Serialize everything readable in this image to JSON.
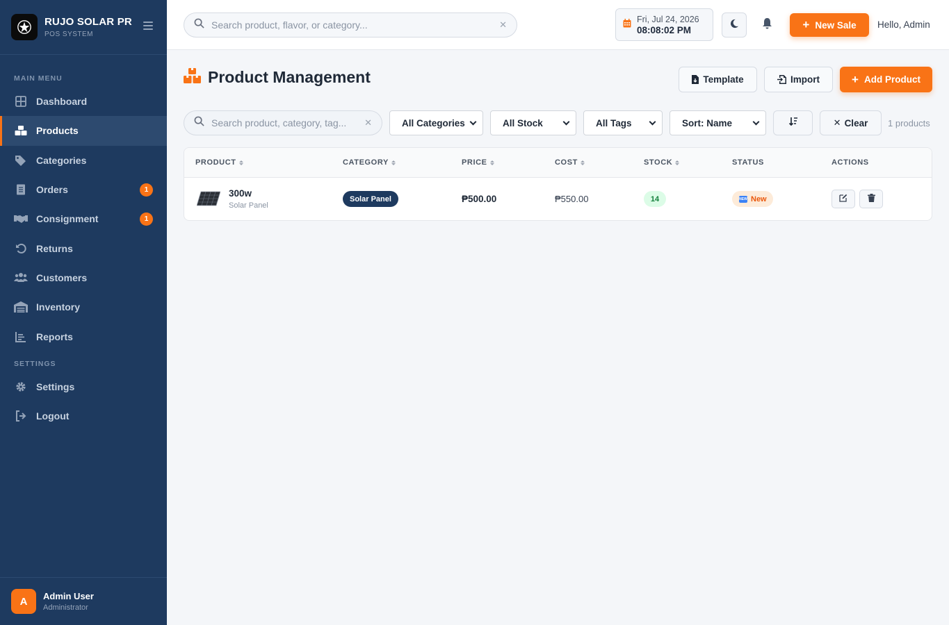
{
  "app": {
    "brand_name": "RUJO SOLAR PRO",
    "brand_sub": "POS SYSTEM"
  },
  "sidebar": {
    "main_label": "MAIN MENU",
    "settings_label": "SETTINGS",
    "items": [
      {
        "label": "Dashboard",
        "icon": "dashboard-icon"
      },
      {
        "label": "Products",
        "icon": "boxes-icon",
        "active": true
      },
      {
        "label": "Categories",
        "icon": "tags-icon"
      },
      {
        "label": "Orders",
        "icon": "receipt-icon",
        "badge": "1"
      },
      {
        "label": "Consignment",
        "icon": "handshake-icon",
        "badge": "1"
      },
      {
        "label": "Returns",
        "icon": "undo-icon"
      },
      {
        "label": "Customers",
        "icon": "users-icon"
      },
      {
        "label": "Inventory",
        "icon": "warehouse-icon"
      },
      {
        "label": "Reports",
        "icon": "chart-icon"
      }
    ],
    "settings_items": [
      {
        "label": "Settings",
        "icon": "gear-icon"
      },
      {
        "label": "Logout",
        "icon": "logout-icon"
      }
    ],
    "user": {
      "initial": "A",
      "name": "Admin User",
      "role": "Administrator"
    }
  },
  "topbar": {
    "search_placeholder": "Search product, flavor, or category...",
    "date": "Fri, Jul 24, 2026",
    "time": "08:08:02 PM",
    "new_sale_label": "New Sale",
    "greeting": "Hello, Admin"
  },
  "page": {
    "title": "Product Management",
    "template_label": "Template",
    "import_label": "Import",
    "add_label": "Add Product"
  },
  "filters": {
    "search_placeholder": "Search product, category, tag...",
    "category": "All Categories",
    "stock": "All Stock",
    "tags": "All Tags",
    "sort": "Sort: Name",
    "clear_label": "Clear",
    "count": "1 products"
  },
  "table": {
    "columns": [
      "PRODUCT",
      "CATEGORY",
      "PRICE",
      "COST",
      "STOCK",
      "STATUS",
      "ACTIONS"
    ],
    "rows": [
      {
        "name": "300w",
        "subtitle": "Solar Panel",
        "category": "Solar Panel",
        "price": "₱500.00",
        "cost": "₱550.00",
        "stock": "14",
        "status": "New"
      }
    ]
  },
  "colors": {
    "accent": "#f97316",
    "sidebar": "#1e3a5f",
    "stock_ok": "#15803d"
  }
}
